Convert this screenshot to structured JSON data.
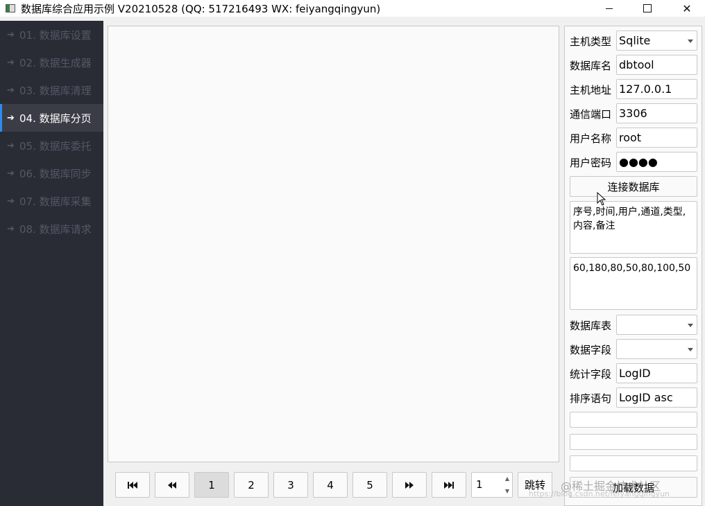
{
  "window": {
    "title": "数据库综合应用示例 V20210528 (QQ: 517216493 WX: feiyangqingyun)",
    "close_glyph": "✕"
  },
  "sidebar": {
    "arrow_glyph": "➔",
    "items": [
      {
        "label": "01. 数据库设置"
      },
      {
        "label": "02. 数据生成器"
      },
      {
        "label": "03. 数据库清理"
      },
      {
        "label": "04. 数据库分页"
      },
      {
        "label": "05. 数据库委托"
      },
      {
        "label": "06. 数据库同步"
      },
      {
        "label": "07. 数据库采集"
      },
      {
        "label": "08. 数据库请求"
      }
    ],
    "active_index": 3,
    "active_color": "#2d8cf0",
    "bg_color": "#292c35"
  },
  "pager": {
    "first_icon": "first-page-icon",
    "prev_icon": "previous-page-icon",
    "next_icon": "next-page-icon",
    "last_icon": "last-page-icon",
    "pages": [
      "1",
      "2",
      "3",
      "4",
      "5"
    ],
    "current_page": "1",
    "jump_value": "1",
    "jump_label": "跳转"
  },
  "settings": {
    "host_type_label": "主机类型",
    "host_type_value": "Sqlite",
    "db_name_label": "数据库名",
    "db_name_value": "dbtool",
    "host_addr_label": "主机地址",
    "host_addr_value": "127.0.0.1",
    "port_label": "通信端口",
    "port_value": "3306",
    "user_label": "用户名称",
    "user_value": "root",
    "password_label": "用户密码",
    "password_value": "●●●●",
    "connect_label": "连接数据库",
    "columns_text": "序号,时间,用户,通道,类型,内容,备注",
    "widths_text": "60,180,80,50,80,100,50",
    "table_label": "数据库表",
    "table_value": "",
    "field_label": "数据字段",
    "field_value": "",
    "count_field_label": "统计字段",
    "count_field_value": "LogID",
    "order_label": "排序语句",
    "order_value": "LogID asc",
    "load_label": "加载数据"
  },
  "watermark": {
    "text": "@稀土掘金技术社区",
    "subtext": "https://blog.csdn.net/feiyangqingyun"
  }
}
